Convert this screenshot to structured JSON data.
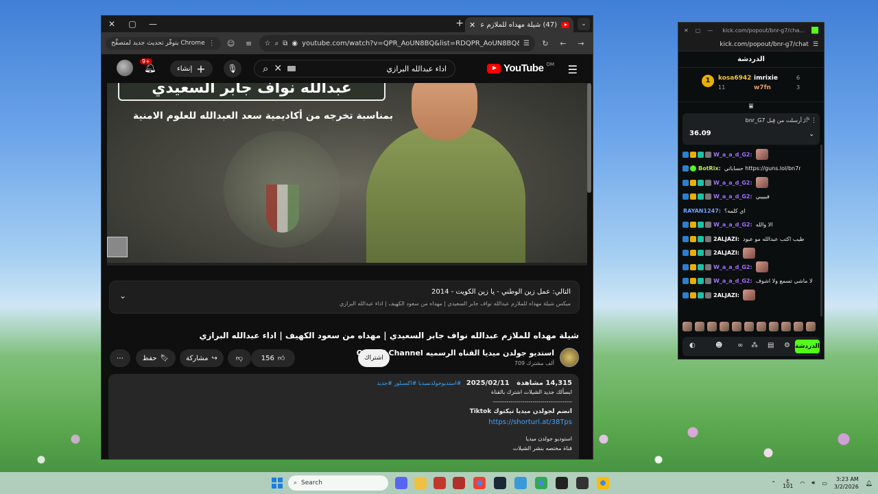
{
  "chrome": {
    "tab_title": "(47) شيلة مهداه للملازم عبدالله نواف",
    "update_chip": "يتوفّر تحديث جديد لمتصفِّح Chrome",
    "url": "youtube.com/watch?v=QPR_AoUN8BQ&list=RDQPR_AoUN8BQ&start_radi..."
  },
  "youtube": {
    "logo": "YouTube",
    "logo_country": "OM",
    "search_text": "اداء عبدالله البرازي",
    "create_label": "إنشاء",
    "notif_count": "9+",
    "video_banner": "عبدالله نواف جابر السعيدي",
    "video_subtitle": "بمناسبة تخرجه من أكاديمية سعد العبدالله للعلوم الامنية",
    "next_label": "التالي: عمل زين الوطني - يا زين الكويت - 2014",
    "mix_label": "ميكس شيلة مهداه للملازم عبدالله نواف جابر السعيدي | مهداه من سعود الكهيف | اداء عبدالله البرازي",
    "video_title": "شيلة مهداه للملازم عبدالله نواف جابر السعيدي | مهداه من سعود الكهيف | اداء عبدالله البرازي",
    "channel_name": "استديو جولدن ميديا القناه الرسميه Official Channel",
    "channel_subs": "709 ألف مشترك",
    "subscribe_label": "اشتراك",
    "like_count": "156",
    "share_label": "مشاركة",
    "save_label": "حفظ",
    "views": "14,315 مشاهدة",
    "date": "2025/02/11",
    "tags": "#استديوجولدنميديا #اكسبلور #جديد",
    "desc_line1": "ايسألك جديد الشيلات اشترك بالقناة",
    "desc_divider": "----------------------------------------",
    "desc_line2": "انضم لجولدن ميديا تيكتوك Tiktok",
    "desc_link": "https://shorturl.at/38Tps",
    "desc_line3": "استوديو جولدن ميديا",
    "desc_line4": "قناة مختصه بنشر الشيلات"
  },
  "kick": {
    "title_url": "kick.com/popout/bnr-g7/cha...",
    "url": "kick.com/popout/bnr-g7/chat",
    "header": "الدردشة",
    "leaders": [
      {
        "rank": "1",
        "name": "kosa6942",
        "count": "11"
      },
      {
        "name": "imrixie",
        "count": "6"
      },
      {
        "name": "w7fn",
        "count": "3"
      }
    ],
    "pinned_header": "bnr_G7 أرسلت من قِبل",
    "pinned_value": "36.09",
    "messages": [
      {
        "user": "W_a_a_d_G2:",
        "text": "",
        "color": "purple",
        "emote": true
      },
      {
        "user": "BotRix:",
        "text": "حساباتي https://guns.lol/bn7r",
        "color": "lime",
        "emote": false
      },
      {
        "user": "W_a_a_d_G2:",
        "text": "",
        "color": "purple",
        "emote": true
      },
      {
        "user": "W_a_a_d_G2:",
        "text": "فييييي",
        "color": "purple",
        "emote": false
      },
      {
        "user": "RAYAN1247:",
        "text": "اي كلمه؟",
        "color": "blue",
        "emote": false
      },
      {
        "user": "W_a_a_d_G2:",
        "text": "الا والله",
        "color": "purple",
        "emote": false
      },
      {
        "user": "2ALJAZI:",
        "text": "طيب اكتب عبدالله مو عبود",
        "color": "white",
        "emote": false
      },
      {
        "user": "2ALJAZI:",
        "text": "",
        "color": "white",
        "emote": true
      },
      {
        "user": "W_a_a_d_G2:",
        "text": "",
        "color": "purple",
        "emote": true
      },
      {
        "user": "W_a_a_d_G2:",
        "text": "لا ماشي تسمع ولا اشوف",
        "color": "purple",
        "emote": false
      },
      {
        "user": "2ALJAZI:",
        "text": "",
        "color": "white",
        "emote": true
      }
    ],
    "send_label": "الدردشة"
  },
  "taskbar": {
    "search_placeholder": "Search",
    "time": "3:23 AM",
    "date": "3/2/2026",
    "lang": "ع",
    "lang2": "101"
  }
}
